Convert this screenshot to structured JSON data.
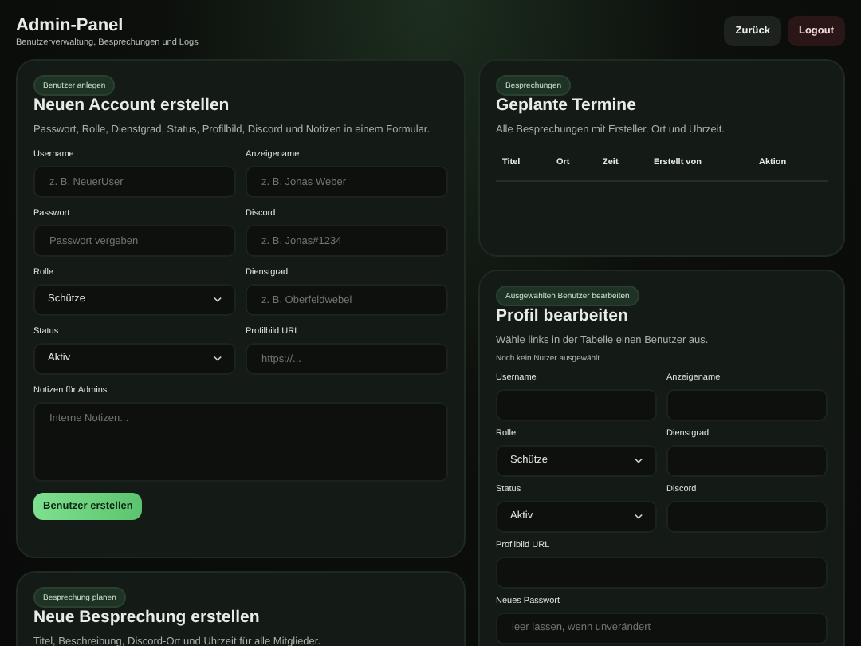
{
  "header": {
    "title": "Admin-Panel",
    "subtitle": "Benutzerverwaltung, Besprechungen und Logs",
    "buttons": [
      {
        "label": "Zurück",
        "kind": "neutral"
      },
      {
        "label": "Logout",
        "kind": "danger"
      }
    ]
  },
  "create_user": {
    "badge": "Benutzer anlegen",
    "title": "Neuen Account erstellen",
    "description": "Passwort, Rolle, Dienstgrad, Status, Profilbild, Discord und Notizen in einem Formular.",
    "fields": [
      {
        "kind": "input",
        "label": "Username",
        "placeholder": "z. B. NeuerUser"
      },
      {
        "kind": "input",
        "label": "Anzeigename",
        "placeholder": "z. B. Jonas Weber"
      },
      {
        "kind": "input",
        "label": "Passwort",
        "placeholder": "Passwort vergeben"
      },
      {
        "kind": "input",
        "label": "Discord",
        "placeholder": "z. B. Jonas#1234"
      },
      {
        "kind": "select",
        "label": "Rolle",
        "value": "Schütze"
      },
      {
        "kind": "input",
        "label": "Dienstgrad",
        "placeholder": "z. B. Oberfeldwebel"
      },
      {
        "kind": "select",
        "label": "Status",
        "value": "Aktiv"
      },
      {
        "kind": "input",
        "label": "Profilbild URL",
        "placeholder": "https://..."
      },
      {
        "kind": "textarea",
        "label": "Notizen für Admins",
        "placeholder": "Interne Notizen..."
      }
    ],
    "submit": "Benutzer erstellen"
  },
  "create_meeting": {
    "badge": "Besprechung planen",
    "title": "Neue Besprechung erstellen",
    "description": "Titel, Beschreibung, Discord-Ort und Uhrzeit für alle Mitglieder."
  },
  "meetings": {
    "badge": "Besprechungen",
    "title": "Geplante Termine",
    "description": "Alle Besprechungen mit Ersteller, Ort und Uhrzeit.",
    "columns": [
      "Titel",
      "Ort",
      "Zeit",
      "Erstellt von",
      "Aktion"
    ]
  },
  "edit_profile": {
    "badge": "Ausgewählten Benutzer bearbeiten",
    "title": "Profil bearbeiten",
    "description": "Wähle links in der Tabelle einen Benutzer aus.",
    "note": "Noch kein Nutzer ausgewählt.",
    "fields": [
      {
        "kind": "input",
        "label": "Username"
      },
      {
        "kind": "input",
        "label": "Anzeigename"
      },
      {
        "kind": "select",
        "label": "Rolle",
        "value": "Schütze"
      },
      {
        "kind": "input",
        "label": "Dienstgrad"
      },
      {
        "kind": "select",
        "label": "Status",
        "value": "Aktiv"
      },
      {
        "kind": "input",
        "label": "Discord"
      },
      {
        "kind": "wide",
        "label": "Profilbild URL"
      },
      {
        "kind": "wide",
        "label": "Neues Passwort",
        "placeholder": "leer lassen, wenn unverändert"
      }
    ]
  }
}
